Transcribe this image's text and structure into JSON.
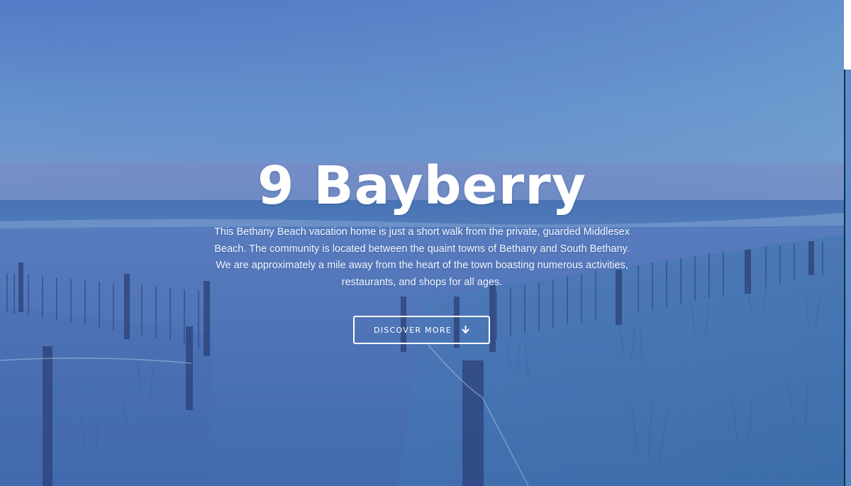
{
  "hero": {
    "title": "9 Bayberry",
    "description_lines": [
      "This Bethany Beach vacation home is just a short walk from the private, guarded Middlesex",
      "Beach. The community is located between the quaint towns of Bethany and South Bethany.",
      "We are approximately a mile away from the heart of the town boasting numerous activities,",
      "restaurants, and shops for all ages."
    ],
    "button": {
      "label": "DISCOVER MORE",
      "icon": "arrow-down-icon"
    },
    "background": "beach-dune-photo",
    "overlay_color": "#3c64be"
  },
  "colors": {
    "text": "#ffffff",
    "sky_top": "#5b86c8",
    "sea": "#3f74b0",
    "sand": "#5a7fbf"
  }
}
